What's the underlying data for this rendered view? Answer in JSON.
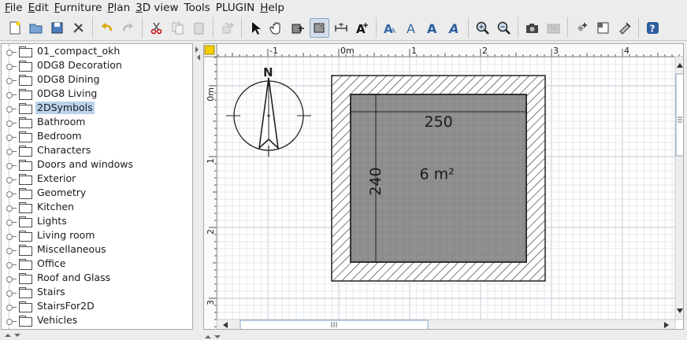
{
  "menu": [
    {
      "label": "File",
      "ul": "F",
      "rest": "ile"
    },
    {
      "label": "Edit",
      "ul": "E",
      "rest": "dit"
    },
    {
      "label": "Furniture",
      "ul": "F",
      "rest": "urniture"
    },
    {
      "label": "Plan",
      "ul": "P",
      "rest": "lan"
    },
    {
      "label": "3D view",
      "ul": "3",
      "rest": "D view"
    },
    {
      "label": "Tools",
      "ul": "",
      "rest": "Tools"
    },
    {
      "label": "PLUGIN",
      "ul": "",
      "rest": "PLUGIN"
    },
    {
      "label": "Help",
      "ul": "H",
      "rest": "elp"
    }
  ],
  "toolbar": [
    [
      "new-home-icon",
      "open-icon",
      "save-icon",
      "preferences-icon"
    ],
    [
      "undo-icon",
      "redo-icon"
    ],
    [
      "cut-icon",
      "copy-icon",
      "paste-icon"
    ],
    [
      "add-furniture-icon"
    ],
    [
      "select-arrow-icon",
      "pan-hand-icon",
      "create-walls-icon",
      "create-rooms-icon",
      "create-dimensions-icon",
      "add-text-icon"
    ],
    [
      "increase-text-size-icon",
      "decrease-text-size-icon",
      "bold-text-icon",
      "italic-text-icon"
    ],
    [
      "zoom-in-icon",
      "zoom-out-icon"
    ],
    [
      "create-photo-icon",
      "create-video-icon"
    ],
    [
      "import-furniture-icon",
      "import-background-icon",
      "export-icon"
    ],
    [
      "help-icon"
    ]
  ],
  "tree": {
    "selected": "2DSymbols",
    "items": [
      "01_compact_okh",
      "0DG8 Decoration",
      "0DG8 Dining",
      "0DG8 Living",
      "2DSymbols",
      "Bathroom",
      "Bedroom",
      "Characters",
      "Doors and windows",
      "Exterior",
      "Geometry",
      "Kitchen",
      "Lights",
      "Living room",
      "Miscellaneous",
      "Office",
      "Roof and Glass",
      "Stairs",
      "StairsFor2D",
      "Vehicles"
    ]
  },
  "plan": {
    "ruler_top": [
      "-1",
      "0m",
      "1",
      "2",
      "3",
      "4"
    ],
    "ruler_left": [
      "0m",
      "1",
      "2",
      "3"
    ],
    "compass_label": "N",
    "room_area": "6 m²",
    "dim_width": "250",
    "dim_height": "240"
  },
  "colors": {
    "selection": "#bcd2ec",
    "grid_minor": "#e3e8ee",
    "grid_major": "#c3cbd6",
    "room_fill": "#8c8c8c",
    "wall_hatch": "#333333"
  }
}
